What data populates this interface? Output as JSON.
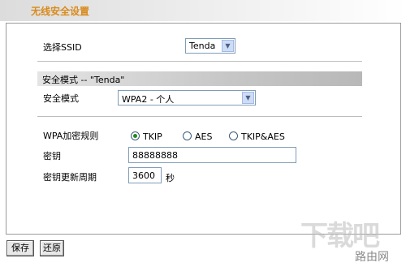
{
  "header": {
    "title": "无线安全设置"
  },
  "ssid": {
    "label": "选择SSID",
    "value": "Tenda"
  },
  "section": {
    "title": "安全模式 -- \"Tenda\""
  },
  "mode": {
    "label": "安全模式",
    "value": "WPA2 - 个人"
  },
  "wpa": {
    "label": "WPA加密规则",
    "options": [
      {
        "label": "TKIP",
        "selected": true
      },
      {
        "label": "AES",
        "selected": false
      },
      {
        "label": "TKIP&AES",
        "selected": false
      }
    ]
  },
  "key": {
    "label": "密钥",
    "value": "88888888"
  },
  "renew": {
    "label": "密钥更新周期",
    "value": "3600",
    "unit": "秒"
  },
  "buttons": {
    "save": "保存",
    "restore": "还原"
  },
  "watermark": {
    "logo": "下载吧",
    "site": "路由网"
  }
}
